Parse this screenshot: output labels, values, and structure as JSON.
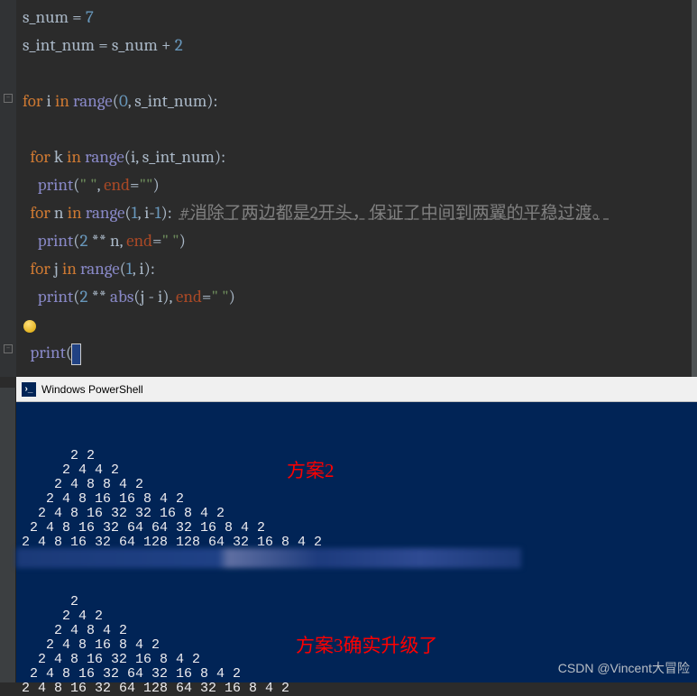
{
  "code": {
    "l1a": "s_num = ",
    "l1b": "7",
    "l2a": "s_int_num = s_num + ",
    "l2b": "2",
    "l3_for": "for",
    "l3_i": " i ",
    "l3_in": "in",
    "l3_range": " range",
    "l3_open": "(",
    "l3_zero": "0",
    "l3_rest": ", s_int_num):",
    "l4_for": "for",
    "l4_k": " k ",
    "l4_in": "in",
    "l4_range": " range",
    "l4_args": "(i, s_int_num):",
    "l5_print": "print",
    "l5_open": "(",
    "l5_str1": "\" \"",
    "l5_comma": ", ",
    "l5_end": "end",
    "l5_eq": "=",
    "l5_str2": "\"\"",
    "l5_close": ")",
    "l6_for": "for",
    "l6_n": " n ",
    "l6_in": "in",
    "l6_range": " range",
    "l6_open": "(",
    "l6_one": "1",
    "l6_mid": ", i-",
    "l6_one2": "1",
    "l6_close": "):  ",
    "l6_comment": "#消除了两边都是2开头，保证了中间到两翼的平稳过渡。",
    "l7_print": "print",
    "l7_open": "(",
    "l7_two": "2",
    "l7_pow": " ** n, ",
    "l7_end": "end",
    "l7_eq": "=",
    "l7_str": "\" \"",
    "l7_close": ")",
    "l8_for": "for",
    "l8_j": " j ",
    "l8_in": "in",
    "l8_range": " range",
    "l8_open": "(",
    "l8_one": "1",
    "l8_rest": ", i):",
    "l9_print": "print",
    "l9_open": "(",
    "l9_two": "2",
    "l9_pow": " ** ",
    "l9_abs": "abs",
    "l9_args": "(j - i), ",
    "l9_end": "end",
    "l9_eq": "=",
    "l9_str": "\" \"",
    "l9_close": ")",
    "l10_print": "print",
    "l10_p": "("
  },
  "terminal": {
    "title": "Windows PowerShell",
    "label1": "方案2",
    "label2": "方案3确实升级了",
    "block1": "      2 2 \n     2 4 4 2 \n    2 4 8 8 4 2 \n   2 4 8 16 16 8 4 2 \n  2 4 8 16 32 32 16 8 4 2 \n 2 4 8 16 32 64 64 32 16 8 4 2 \n2 4 8 16 32 64 128 128 64 32 16 8 4 2 ",
    "block2": "      2 \n     2 4 2 \n    2 4 8 4 2 \n   2 4 8 16 8 4 2 \n  2 4 8 16 32 16 8 4 2 \n 2 4 8 16 32 64 32 16 8 4 2 \n2 4 8 16 32 64 128 64 32 16 8 4 2 "
  },
  "watermark": "CSDN @Vincent大冒险"
}
